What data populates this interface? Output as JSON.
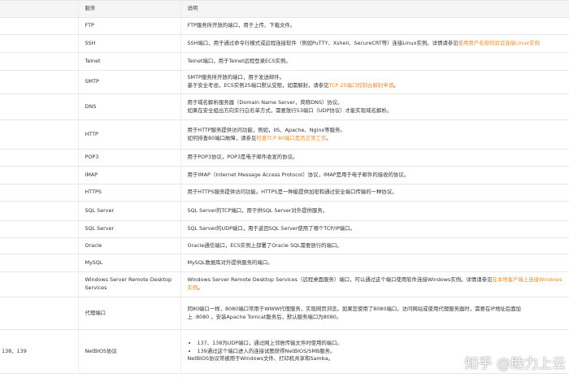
{
  "header": {
    "col0": "",
    "col1": "服务",
    "col2": "说明"
  },
  "rows": [
    {
      "port": "",
      "service": "FTP",
      "lines": [
        "FTP服务所开放的端口，用于上传、下载文件。"
      ]
    },
    {
      "port": "",
      "service": "SSH",
      "lines": [
        "SSH端口，用于通过命令行模式或远程连接软件（例如PuTTY、Xshell、SecureCRT等）连接Linux实例。详情请参见"
      ],
      "link": "使用用户名密码验证连接Linux实例"
    },
    {
      "port": "",
      "service": "Telnet",
      "lines": [
        "Telnet端口，用于Telnet远程登录ECS实例。"
      ]
    },
    {
      "port": "",
      "service": "SMTP",
      "lines": [
        "SMTP服务所开放的端口，用于发送邮件。",
        "基于安全考虑，ECS实例25端口默认受限，如需解封，请参见"
      ],
      "link": "TCP 25端口控制台解封申请",
      "tail": "。"
    },
    {
      "port": "",
      "service": "DNS",
      "lines": [
        "用于域名解析服务器（Domain Name Server，简称DNS）协议。",
        "如果在安全组出方向实行白名单方式，需要放行53端口（UDP协议）才能实现域名解析。"
      ]
    },
    {
      "port": "",
      "service": "HTTP",
      "lines": [
        "用于HTTP服务提供访问功能，例如，IIS、Apache、Nginx等服务。",
        "如何排查80端口故障，请参见"
      ],
      "link": "检查TCP 80端口是否正常工作",
      "tail": "。"
    },
    {
      "port": "",
      "service": "POP3",
      "lines": [
        "用于POP3协议，POP3是电子邮件收发的协议。"
      ]
    },
    {
      "port": "",
      "service": "IMAP",
      "lines": [
        "用于IMAP（Internet Message Access Protocol）协议，IMAP是用于电子邮件的接收的协议。"
      ]
    },
    {
      "port": "",
      "service": "HTTPS",
      "lines": [
        "用于HTTPS服务提供访问功能。HTTPS是一种能提供加密和通过安全端口传输的一种协议。"
      ]
    },
    {
      "port": "",
      "service": "SQL Server",
      "lines": [
        "SQL Server的TCP端口，用于供SQL Server对外提供服务。"
      ]
    },
    {
      "port": "",
      "service": "SQL Server",
      "lines": [
        "SQL Server的UDP端口，用于返回SQL Server使用了哪个TCP/IP端口。"
      ]
    },
    {
      "port": "",
      "service": "Oracle",
      "lines": [
        "Oracle通信端口，ECS实例上部署了Oracle SQL需要放行的端口。"
      ]
    },
    {
      "port": "",
      "service": "MySQL",
      "lines": [
        "MySQL数据库对外提供服务的端口。"
      ]
    },
    {
      "port": "",
      "service": "Windows Server Remote Desktop Services",
      "lines": [
        "Windows Server Remote Desktop Services（远程桌面服务）端口，可以通过这个端口使用软件连接Windows实例。详情请参见"
      ],
      "link": "在本地客户端上连接Windows实例",
      "tail": "。"
    },
    {
      "port": "",
      "service": "代理端口",
      "lines": [
        "同80端口一样，8080端口常用于WWW代理服务，实现网页浏览。如果您使用了8080端口，访问网站或使用代理服务器时，需要在IP地址后面加",
        "上 :8080 。安装Apache Tomcat服务后，默认服务端口为8080。"
      ]
    },
    {
      "port": "138、139",
      "service": "NetBIOS协议",
      "bullets": [
        "137、138为UDP端口，通过网上邻居传输文件时使用的端口。",
        "139通过这个端口进入的连接试图获得NetBIOS/SMB服务。"
      ],
      "lines": [
        "NetBIOS协议常被用于Windows文件、打印机共享和Samba。"
      ]
    }
  ],
  "watermark": "知乎 @助力上云"
}
